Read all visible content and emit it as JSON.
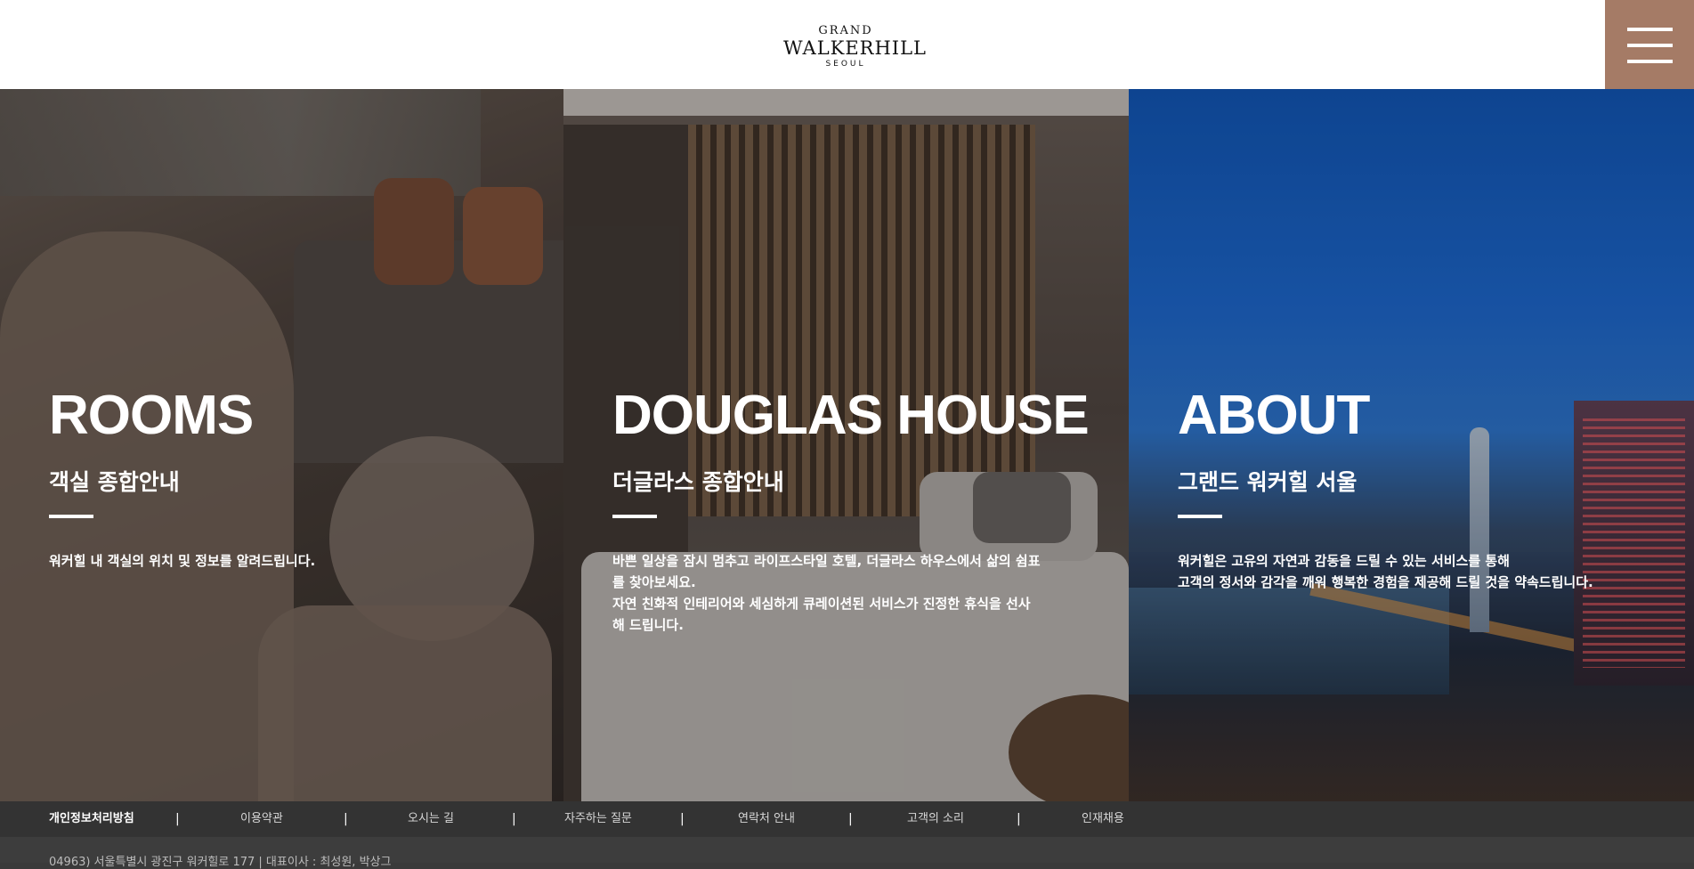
{
  "header": {
    "logo": {
      "line1": "GRAND",
      "line2": "WALKERHILL",
      "line3": "SEOUL"
    },
    "menu_icon": "hamburger-menu-icon"
  },
  "panels": [
    {
      "title": "ROOMS",
      "subtitle": "객실 종합안내",
      "description": "워커힐 내 객실의 위치 및 정보를 알려드립니다."
    },
    {
      "title": "DOUGLAS HOUSE",
      "subtitle": "더글라스 종합안내",
      "description": "바쁜 일상을 잠시 멈추고 라이프스타일 호텔, 더글라스 하우스에서 삶의 쉼표\n를 찾아보세요.\n자연 친화적 인테리어와 세심하게 큐레이션된 서비스가 진정한 휴식을 선사\n해 드립니다."
    },
    {
      "title": "ABOUT",
      "subtitle": "그랜드 워커힐 서울",
      "description": "워커힐은 고유의 자연과 감동을 드릴 수 있는 서비스를 통해\n고객의 정서와 감각을 깨워 행복한 경험을 제공해 드릴 것을 약속드립니다."
    }
  ],
  "footer": {
    "links": [
      "개인정보처리방침",
      "이용약관",
      "오시는 길",
      "자주하는 질문",
      "연락처 안내",
      "고객의 소리",
      "인재채용"
    ],
    "separator": "|",
    "address": "04963) 서울특별시 광진구 워커힐로 177 | 대표이사 : 최성원, 박상그"
  },
  "colors": {
    "menu_button": "#a57b66",
    "footer_nav": "#333333",
    "footer_info": "#3d3d3d"
  }
}
